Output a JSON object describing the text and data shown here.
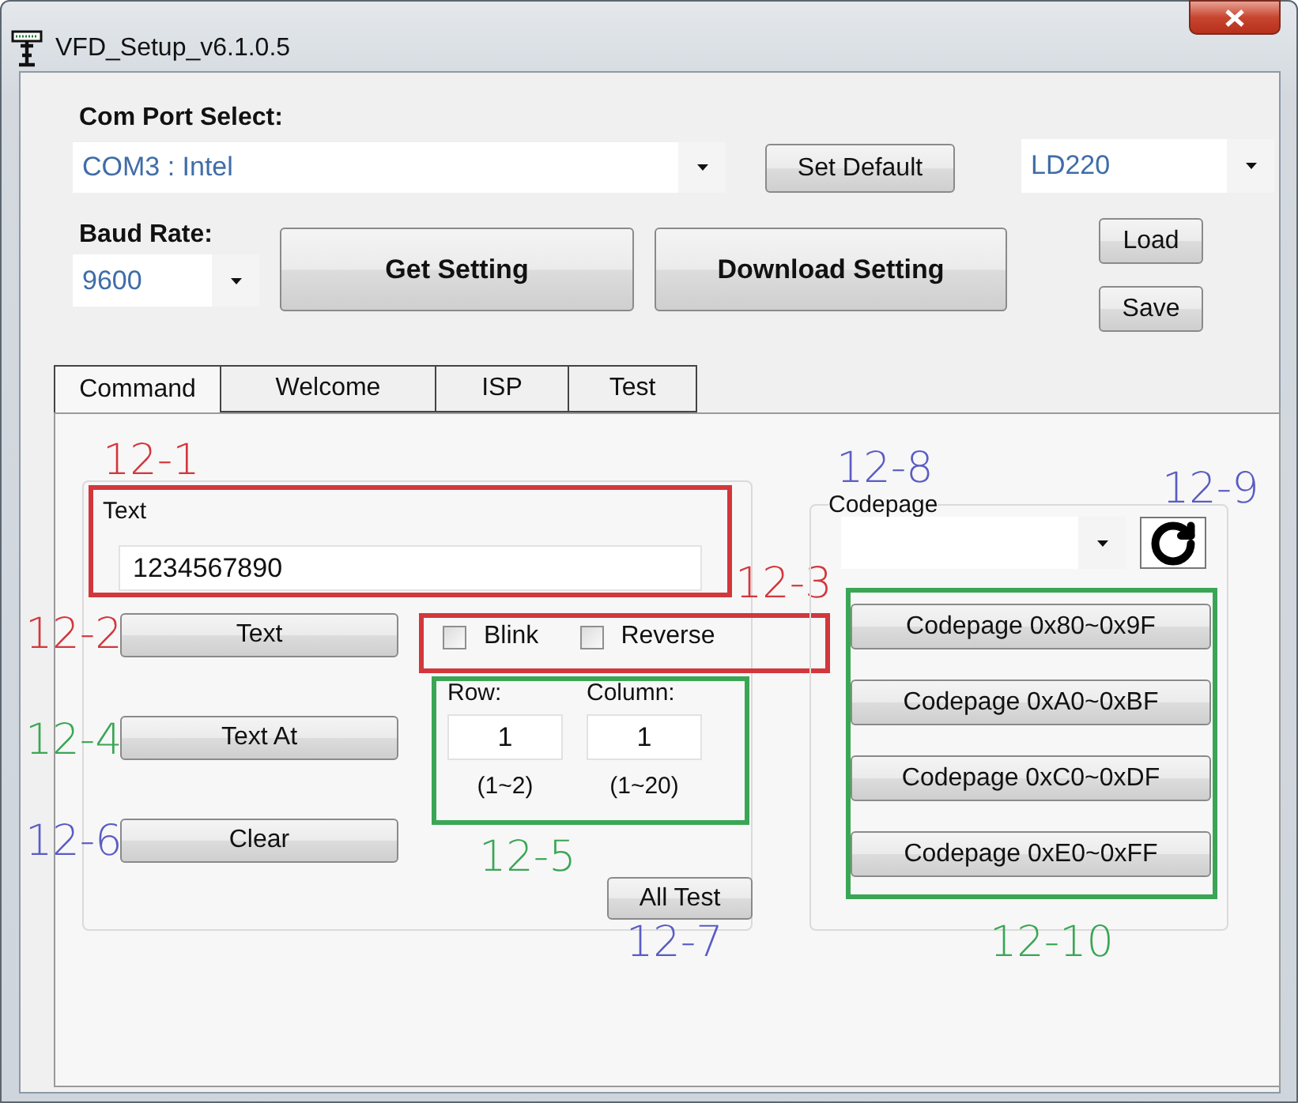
{
  "window": {
    "title": "VFD_Setup_v6.1.0.5"
  },
  "com_port": {
    "label": "Com Port Select:",
    "value": "COM3 : Intel"
  },
  "set_default_button": "Set Default",
  "device": {
    "value": "LD220"
  },
  "baud_rate": {
    "label": "Baud Rate:",
    "value": "9600"
  },
  "action_buttons": [
    "Get Setting",
    "Download Setting"
  ],
  "file_buttons": [
    "Load",
    "Save"
  ],
  "tabs": [
    {
      "label": "Command",
      "selected": true
    },
    {
      "label": "Welcome",
      "selected": false
    },
    {
      "label": "ISP",
      "selected": false
    },
    {
      "label": "Test",
      "selected": false
    }
  ],
  "command_tab": {
    "text_group": {
      "label": "Text",
      "value": "1234567890",
      "annotation": {
        "label": "12-1",
        "color": "#d2373c",
        "framed": true
      }
    },
    "text_button": {
      "label": "Text",
      "annotation": {
        "label": "12-2",
        "color": "#d2373c",
        "framed": false
      }
    },
    "options": {
      "items": [
        {
          "label": "Blink",
          "checked": false
        },
        {
          "label": "Reverse",
          "checked": false
        }
      ],
      "annotation": {
        "label": "12-3",
        "color": "#d2373c",
        "framed": true
      }
    },
    "text_at_button": {
      "label": "Text At",
      "annotation": {
        "label": "12-4",
        "color": "#3aa655",
        "framed": false
      }
    },
    "position": {
      "fields": [
        {
          "label": "Row:",
          "value": "1",
          "range": "(1~2)"
        },
        {
          "label": "Column:",
          "value": "1",
          "range": "(1~20)"
        }
      ],
      "annotation": {
        "label": "12-5",
        "color": "#3aa655",
        "framed": true
      }
    },
    "clear_button": {
      "label": "Clear",
      "annotation": {
        "label": "12-6",
        "color": "#5a5cc4",
        "framed": false
      }
    },
    "all_test_button": {
      "label": "All Test",
      "annotation": {
        "label": "12-7",
        "color": "#5a5cc4",
        "framed": false
      }
    },
    "codepage": {
      "label": "Codepage",
      "annotation": {
        "label": "12-8",
        "color": "#5a5cc4",
        "framed": false
      },
      "refresh_annotation": {
        "label": "12-9",
        "color": "#5a5cc4",
        "framed": false
      },
      "buttons": [
        "Codepage 0x80~0x9F",
        "Codepage 0xA0~0xBF",
        "Codepage 0xC0~0xDF",
        "Codepage 0xE0~0xFF"
      ],
      "buttons_annotation": {
        "label": "12-10",
        "color": "#3aa655",
        "framed": true
      }
    }
  }
}
